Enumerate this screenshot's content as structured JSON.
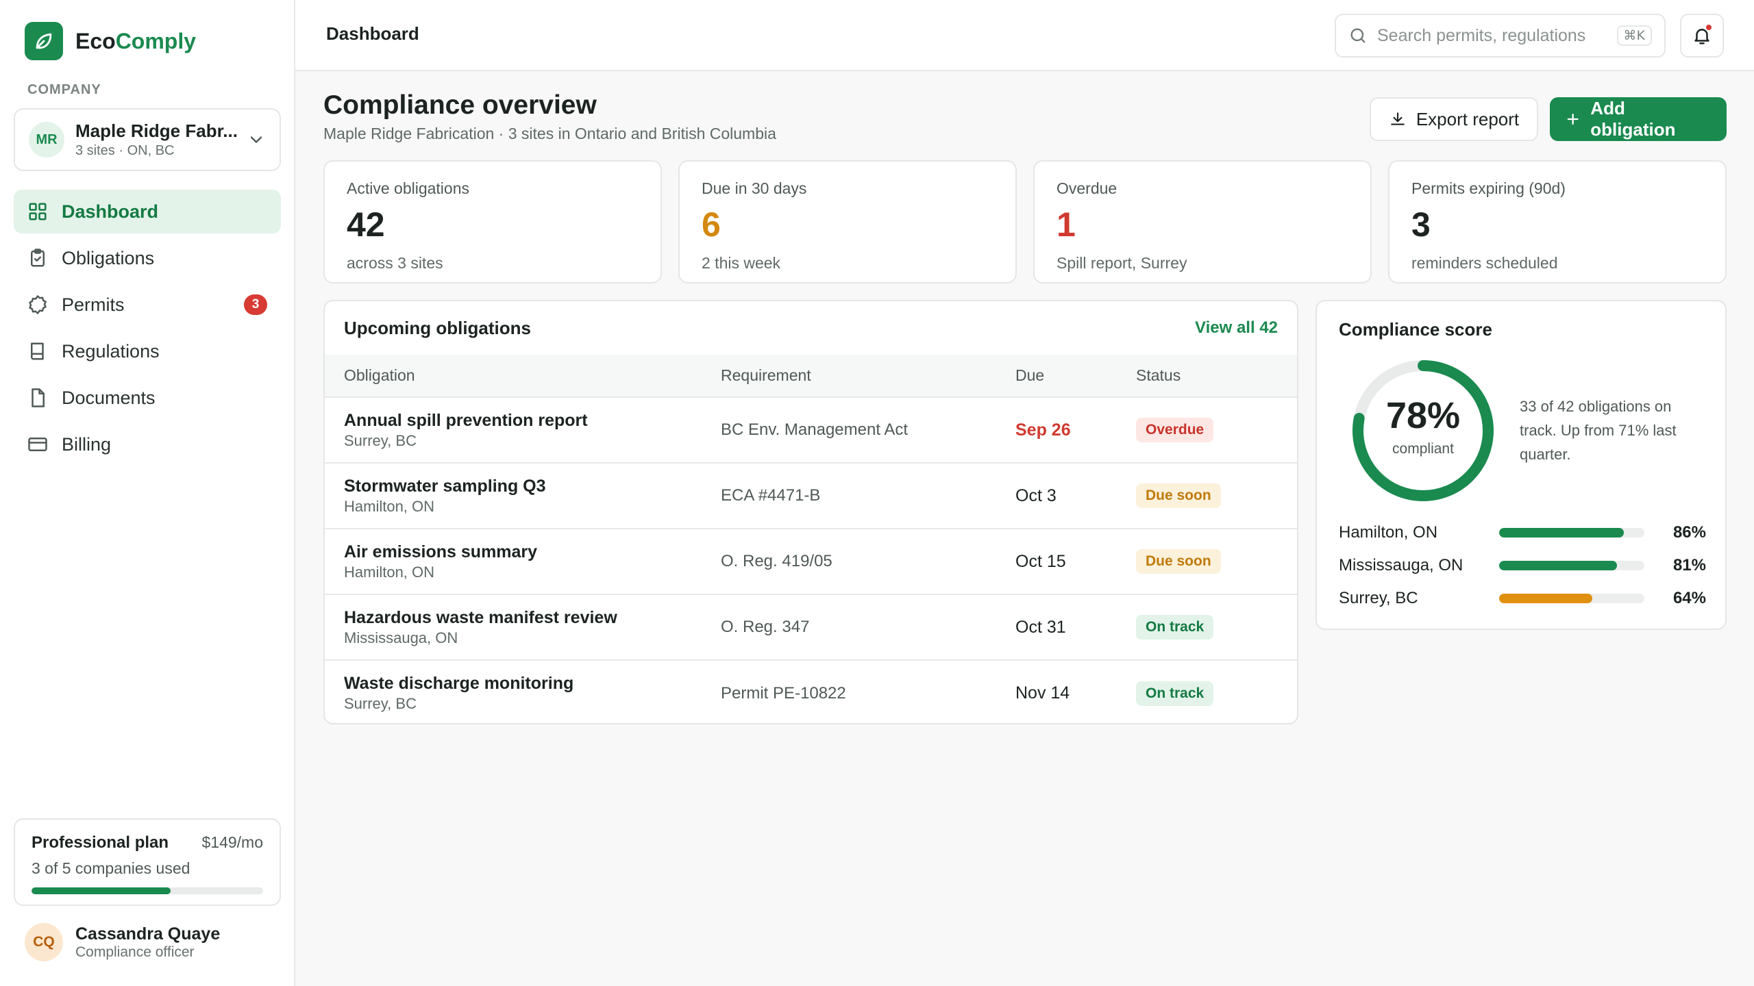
{
  "brand": {
    "name_prefix": "Eco",
    "name_accent": "Comply",
    "accent": "#1a8a4f"
  },
  "sidebar": {
    "section_label": "COMPANY",
    "company": {
      "initials": "MR",
      "name": "Maple Ridge Fabr...",
      "sub": "3 sites · ON, BC"
    },
    "items": [
      {
        "label": "Dashboard",
        "icon": "grid-icon",
        "active": true
      },
      {
        "label": "Obligations",
        "icon": "clipboard-icon"
      },
      {
        "label": "Permits",
        "icon": "badge-icon",
        "badge": "3"
      },
      {
        "label": "Regulations",
        "icon": "book-icon"
      },
      {
        "label": "Documents",
        "icon": "file-icon"
      },
      {
        "label": "Billing",
        "icon": "credit-card-icon"
      }
    ],
    "plan": {
      "name": "Professional plan",
      "price": "$149/mo",
      "usage": "3 of 5 companies used",
      "used": 3,
      "total": 5
    },
    "user": {
      "initials": "CQ",
      "name": "Cassandra Quaye",
      "role": "Compliance officer"
    }
  },
  "topbar": {
    "title": "Dashboard",
    "search": {
      "placeholder": "Search permits, regulations",
      "value": "",
      "shortcut": "⌘K"
    },
    "notifications": {
      "unread": true
    }
  },
  "page": {
    "title": "Compliance overview",
    "subtitle": "Maple Ridge Fabrication · 3 sites in Ontario and British Columbia",
    "export_label": "Export report",
    "add_label": "Add obligation"
  },
  "stats": [
    {
      "label": "Active obligations",
      "value": "42",
      "note": "across 3 sites",
      "color": "#1c2321"
    },
    {
      "label": "Due in 30 days",
      "value": "6",
      "note": "2 this week",
      "color": "#d4880f"
    },
    {
      "label": "Overdue",
      "value": "1",
      "note": "Spill report, Surrey",
      "color": "#d03a30"
    },
    {
      "label": "Permits expiring (90d)",
      "value": "3",
      "note": "reminders scheduled",
      "color": "#1c2321"
    }
  ],
  "upcoming": {
    "title": "Upcoming obligations",
    "view_all": "View all 42",
    "columns": [
      "Obligation",
      "Requirement",
      "Due",
      "Status"
    ],
    "rows": [
      {
        "name": "Annual spill prevention report",
        "site": "Surrey, BC",
        "requirement": "BC Env. Management Act",
        "due": "Sep 26",
        "status": "Overdue",
        "kind": "overdue"
      },
      {
        "name": "Stormwater sampling Q3",
        "site": "Hamilton, ON",
        "requirement": "ECA #4471-B",
        "due": "Oct 3",
        "status": "Due soon",
        "kind": "soon"
      },
      {
        "name": "Air emissions summary",
        "site": "Hamilton, ON",
        "requirement": "O. Reg. 419/05",
        "due": "Oct 15",
        "status": "Due soon",
        "kind": "soon"
      },
      {
        "name": "Hazardous waste manifest review",
        "site": "Mississauga, ON",
        "requirement": "O. Reg. 347",
        "due": "Oct 31",
        "status": "On track",
        "kind": "ok"
      },
      {
        "name": "Waste discharge monitoring",
        "site": "Surrey, BC",
        "requirement": "Permit PE-10822",
        "due": "Nov 14",
        "status": "On track",
        "kind": "ok"
      }
    ]
  },
  "score": {
    "title": "Compliance score",
    "percent": 78,
    "percent_label": "78%",
    "caption": "compliant",
    "description": "33 of 42 obligations on track. Up from 71% last quarter.",
    "sites": [
      {
        "name": "Hamilton, ON",
        "value": 86,
        "label": "86%",
        "color": "#1a8a4f"
      },
      {
        "name": "Mississauga, ON",
        "value": 81,
        "label": "81%",
        "color": "#1a8a4f"
      },
      {
        "name": "Surrey, BC",
        "value": 64,
        "label": "64%",
        "color": "#e0900f"
      }
    ]
  }
}
